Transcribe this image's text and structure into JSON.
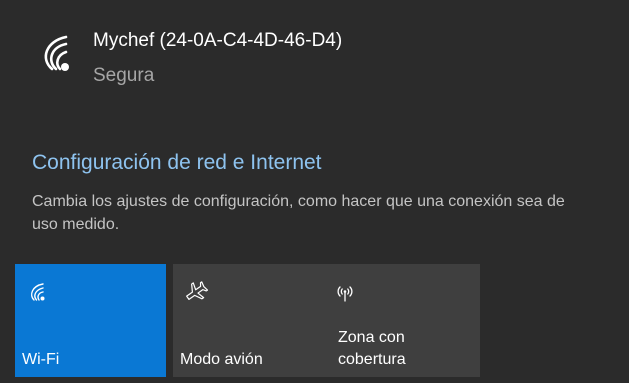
{
  "network": {
    "name": "Mychef (24-0A-C4-4D-46-D4)",
    "status": "Segura",
    "icon": "wifi-secure-icon"
  },
  "settings": {
    "link_label": "Configuración de red e Internet",
    "description": "Cambia los ajustes de configuración, como hacer que una conexión sea de uso medido."
  },
  "quick_actions": [
    {
      "label": "Wi-Fi",
      "icon": "wifi-icon",
      "active": true
    },
    {
      "label": "Modo avión",
      "icon": "airplane-icon",
      "active": false
    },
    {
      "label": "Zona con\ncobertura",
      "icon": "hotspot-icon",
      "active": false
    }
  ],
  "colors": {
    "background": "#2b2b2b",
    "tile": "#3f3f3f",
    "accent": "#0a78d4",
    "link": "#8ec3ef"
  }
}
